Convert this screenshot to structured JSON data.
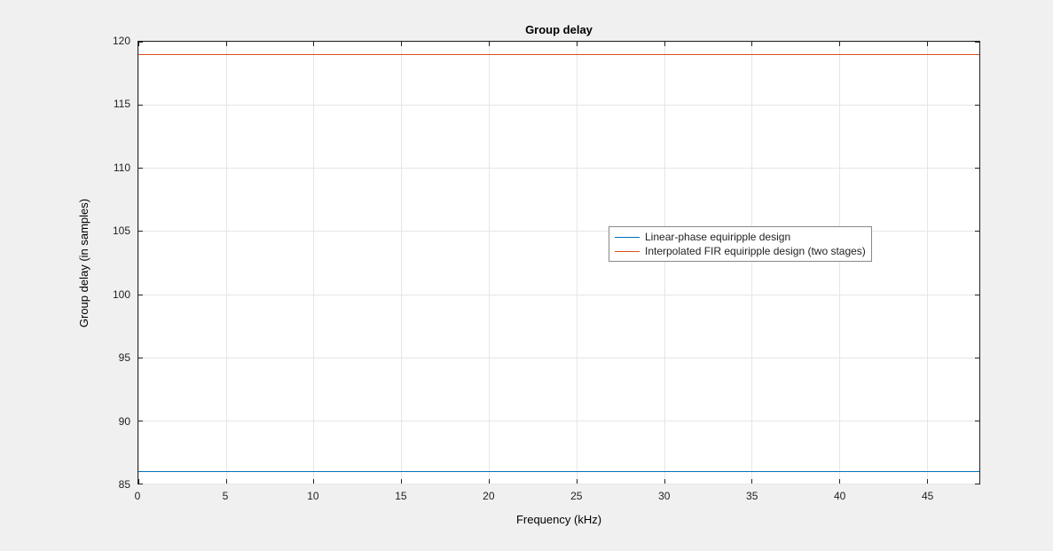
{
  "chart_data": {
    "type": "line",
    "title": "Group delay",
    "xlabel": "Frequency (kHz)",
    "ylabel": "Group delay (in samples)",
    "xlim": [
      0,
      48
    ],
    "ylim": [
      85,
      120
    ],
    "xticks": [
      0,
      5,
      10,
      15,
      20,
      25,
      30,
      35,
      40,
      45
    ],
    "yticks": [
      85,
      90,
      95,
      100,
      105,
      110,
      115,
      120
    ],
    "series": [
      {
        "name": "Linear-phase equiripple design",
        "color": "#0072bd",
        "x": [
          0,
          48
        ],
        "values": [
          86,
          86
        ]
      },
      {
        "name": "Interpolated FIR equiripple design (two stages)",
        "color": "#d95319",
        "x": [
          0,
          48
        ],
        "values": [
          119,
          119
        ]
      }
    ],
    "legend_position": "right-middle",
    "grid": true
  }
}
